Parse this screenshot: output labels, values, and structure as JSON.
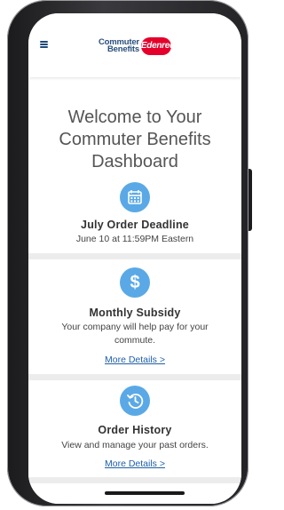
{
  "header": {
    "logo_line1": "Commuter",
    "logo_line2": "Benefits",
    "logo_badge": "Edenred"
  },
  "welcome": {
    "line1": "Welcome to Your",
    "line2": "Commuter Benefits",
    "line3": "Dashboard"
  },
  "cards": [
    {
      "icon": "calendar-icon",
      "title": "July Order Deadline",
      "text": "June 10 at 11:59PM Eastern"
    },
    {
      "icon": "dollar-icon",
      "title": "Monthly Subsidy",
      "text_line1": "Your company will help pay for your",
      "text_line2": "commute.",
      "link": "More Details >"
    },
    {
      "icon": "history-icon",
      "title": "Order History",
      "text": "View and manage your past orders.",
      "link": "More Details >"
    }
  ],
  "colors": {
    "accent_blue": "#5aa9e6",
    "link_blue": "#1f5fa8",
    "brand_navy": "#2a4f7c",
    "brand_red": "#e4002b"
  }
}
